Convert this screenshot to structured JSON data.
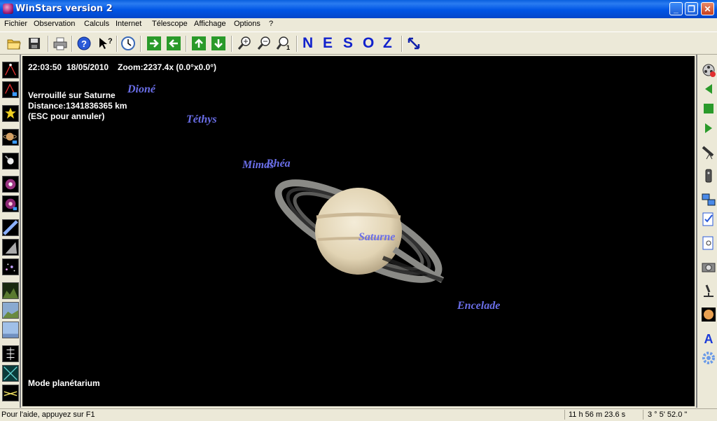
{
  "window": {
    "title": "WinStars version 2"
  },
  "menu": [
    "Fichier",
    "Observation",
    "Calculs",
    "Internet",
    "Télescope",
    "Affichage",
    "Options",
    "?"
  ],
  "toolbar": {
    "directions": [
      "N",
      "E",
      "S",
      "O",
      "Z"
    ]
  },
  "hud": {
    "time": "22:03:50",
    "date": "18/05/2010",
    "zoom": "Zoom:2237.4x (0.0°x0.0°)",
    "lock": "Verrouillé sur Saturne",
    "distance": "Distance:1341836365 km",
    "esc": "(ESC pour annuler)",
    "mode": "Mode planétarium"
  },
  "bodies": {
    "dione": "Dioné",
    "tethys": "Téthys",
    "mimas": "Mimas",
    "rhea": "Rhéa",
    "saturne": "Saturne",
    "encelade": "Encelade"
  },
  "status": {
    "help": "Pour l'aide, appuyez sur F1",
    "ra": "11 h  56 m  23.6 s",
    "dec": "3 °   5'  52.0 \""
  },
  "colors": {
    "titlebar": "#0055e5",
    "sky": "#000000",
    "moon_label": "#6a6ee8",
    "direction": "#1122cc"
  }
}
